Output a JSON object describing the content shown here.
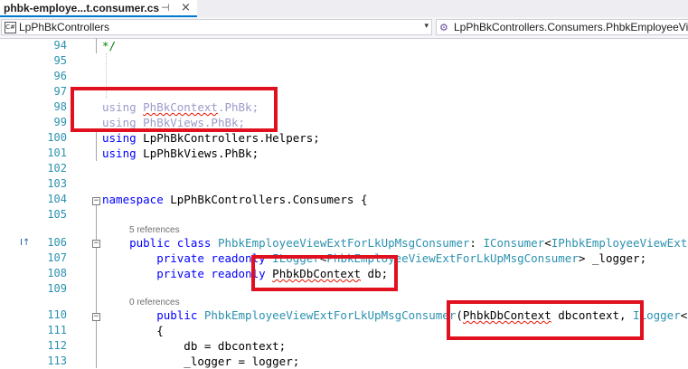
{
  "tab": {
    "title": "phbk-employe...t.consumer.cs",
    "pin": "⊣",
    "close": "×"
  },
  "nav": {
    "project": "LpPhBkControllers",
    "project_icon": "C#",
    "type_name": "LpPhBkControllers.Consumers.PhbkEmployeeVie",
    "arrow": "▾"
  },
  "margin_icon": "I↑",
  "code_lines": [
    {
      "num": "94",
      "html": "<span class=\"cm\">*/</span>"
    },
    {
      "num": "95",
      "html": ""
    },
    {
      "num": "96",
      "html": ""
    },
    {
      "num": "97",
      "html": ""
    },
    {
      "num": "98",
      "html": "<span class=\"dim\">using </span><span class=\"dim sq\">PhBkContext</span><span class=\"dim\">.PhBk;</span>"
    },
    {
      "num": "99",
      "html": "<span class=\"dim\">using </span><span class=\"dim sq\">PhBkViews</span><span class=\"dim\">.PhBk;</span>"
    },
    {
      "num": "100",
      "html": "<span class=\"kw\">using</span> LpPhBkControllers.Helpers;"
    },
    {
      "num": "101",
      "html": "<span class=\"kw\">using</span> LpPhBkViews.PhBk;"
    },
    {
      "num": "102",
      "html": ""
    },
    {
      "num": "103",
      "html": ""
    },
    {
      "num": "104",
      "html": "<span class=\"kw\">namespace</span> LpPhBkControllers.Consumers {"
    },
    {
      "num": "105",
      "html": ""
    },
    {
      "num": "106",
      "html": "    <span class=\"kw\">public class</span> <span class=\"ty\">PhbkEmployeeViewExtForLkUpMsgConsumer</span>: <span class=\"ty\">IConsumer</span>&lt;<span class=\"ty\">IPhbkEmployeeViewExt</span>"
    },
    {
      "num": "107",
      "html": "        <span class=\"kw\">private readonly</span> <span class=\"ty\">ILogger</span>&lt;<span class=\"ty\">PhbkEmployeeViewExtForLkUpMsgConsumer</span>&gt; _logger;"
    },
    {
      "num": "108",
      "html": "        <span class=\"kw\">private readonly</span> <span class=\"sq\">PhbkDbContext</span> db;"
    },
    {
      "num": "109",
      "html": ""
    },
    {
      "num": "110",
      "html": "        <span class=\"kw\">public</span> <span class=\"ty\">PhbkEmployeeViewExtForLkUpMsgConsumer</span>(<span class=\"sq\">PhbkDbContext</span> dbcontext, <span class=\"ty\">ILogger</span>&lt;"
    },
    {
      "num": "111",
      "html": "        {"
    },
    {
      "num": "112",
      "html": "            db = dbcontext;"
    },
    {
      "num": "113",
      "html": "            _logger = logger;"
    }
  ],
  "references": [
    {
      "text": "5 references"
    },
    {
      "text": "0 references"
    }
  ]
}
